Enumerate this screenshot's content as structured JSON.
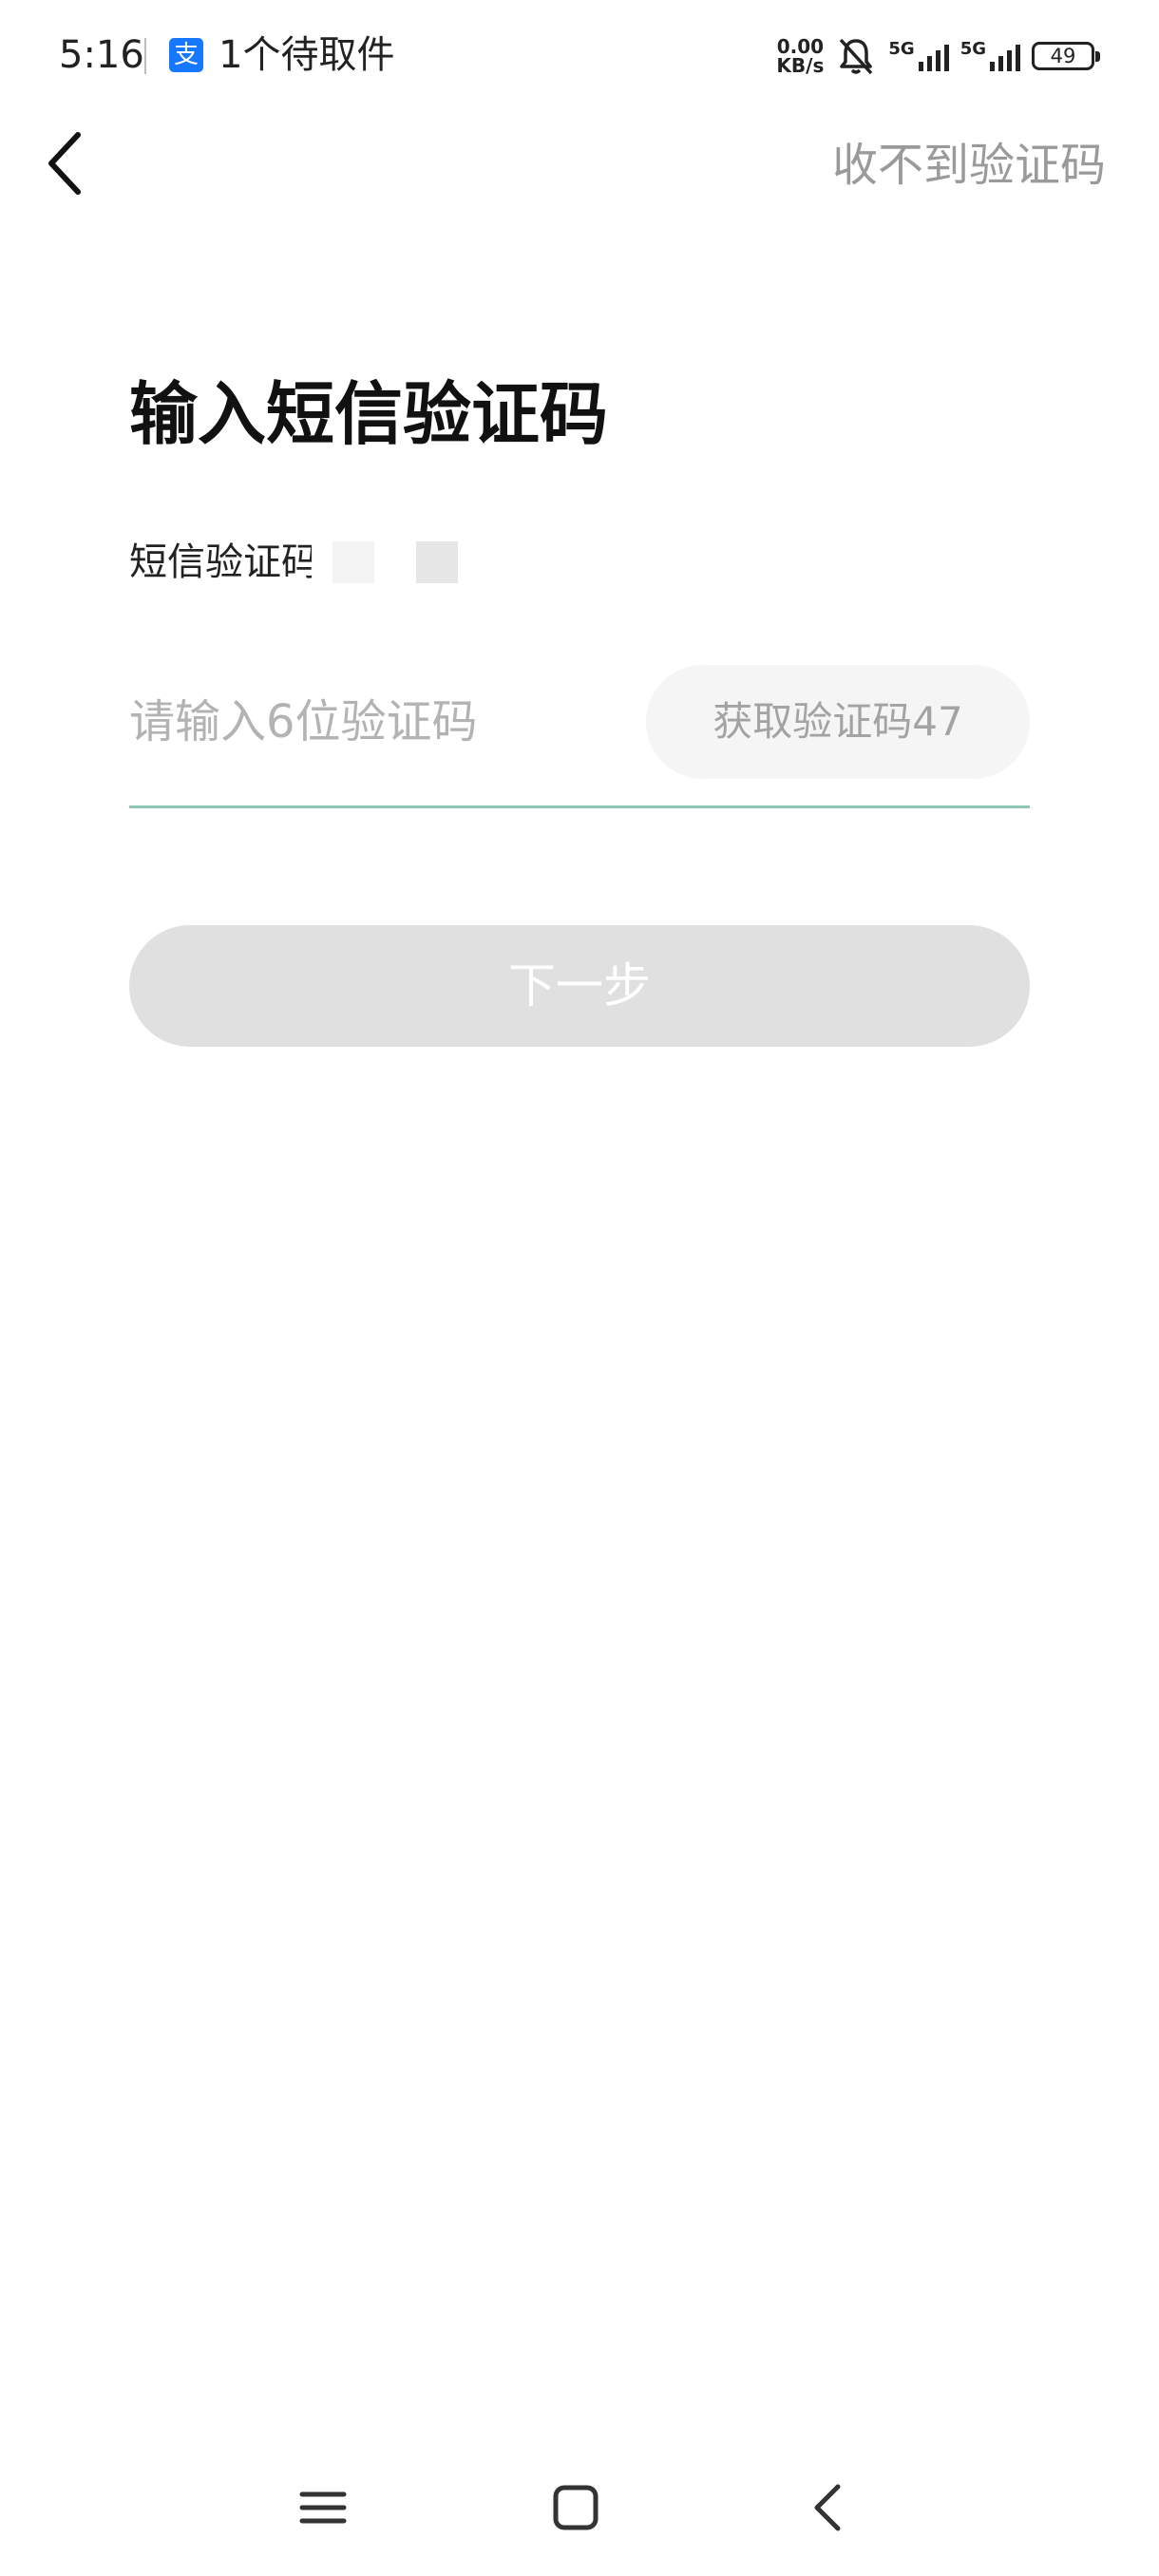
{
  "status_bar": {
    "time": "5:16",
    "app_icon_glyph": "支",
    "notification": "1个待取件",
    "net_speed_value": "0.00",
    "net_speed_unit": "KB/s",
    "signal1_label": "5G",
    "signal2_label": "5G",
    "battery": "49",
    "icons": [
      "alipay-icon",
      "bell-muted-icon",
      "signal-icon",
      "battery-icon"
    ]
  },
  "header": {
    "back_icon": "chevron-left-icon",
    "cant_receive_label": "收不到验证码"
  },
  "main": {
    "title": "输入短信验证码",
    "subtitle": "短信验证码",
    "code_input_placeholder": "请输入6位验证码",
    "code_input_value": "",
    "get_code_label": "获取验证码47",
    "next_button_label": "下一步"
  },
  "nav_bar": {
    "icons": [
      "menu-icon",
      "home-icon",
      "back-icon"
    ]
  },
  "colors": {
    "accent_underline": "#8fc5b4",
    "disabled_button": "#e0e0e0",
    "secondary_text": "#9a9a9a",
    "alipay_blue": "#1677ff"
  }
}
